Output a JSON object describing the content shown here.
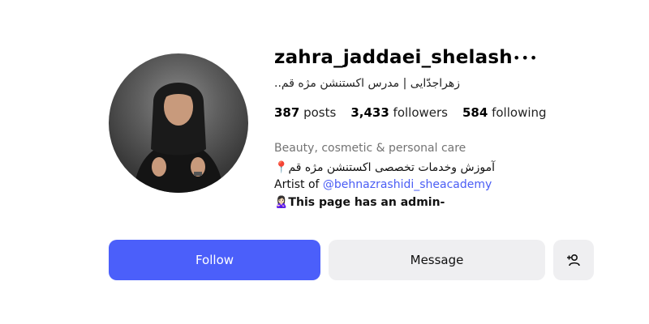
{
  "profile": {
    "username": "zahra_jaddaei_shelash",
    "full_name": "زهراجدّایی | مدرس اکستنشن مژه قم..",
    "stats": {
      "posts_count": "387",
      "posts_label": "posts",
      "followers_count": "3,433",
      "followers_label": "followers",
      "following_count": "584",
      "following_label": "following"
    },
    "category": "Beauty, cosmetic & personal care",
    "bio": {
      "line1": "📍آموزش وخدمات تخصصی اکستنشن مژه قم",
      "line2_prefix": "Artist of ",
      "line2_mention": "@behnazrashidi_sheacademy",
      "line3": "🙎🏻‍♀️This page has an admin-"
    }
  },
  "actions": {
    "follow_label": "Follow",
    "message_label": "Message",
    "more_icon": "more-horizontal-icon",
    "add_user_icon": "add-user-icon"
  },
  "colors": {
    "follow_bg": "#4b5ffa",
    "secondary_bg": "#efeff1",
    "mention": "#4a5df5"
  }
}
